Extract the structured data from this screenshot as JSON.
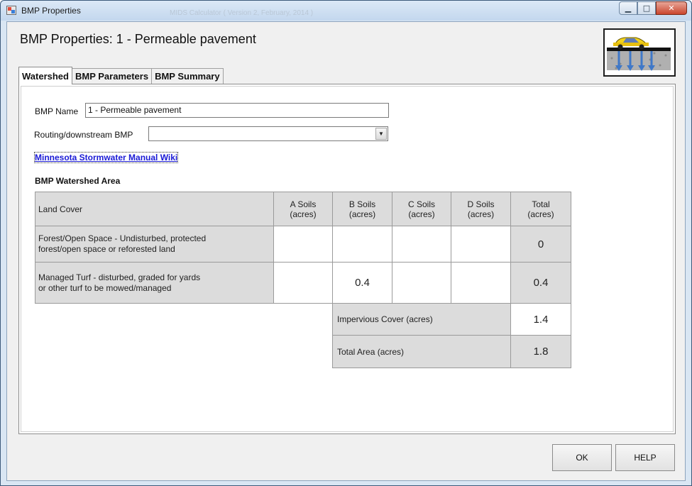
{
  "window": {
    "title": "BMP Properties",
    "background_title": "MIDS Calculator ( Version 2, February, 2014 )",
    "controls": {
      "minimize": "▁",
      "maximize": "□",
      "close": "✕"
    }
  },
  "header": {
    "title": "BMP Properties: 1 - Permeable pavement"
  },
  "tabs": [
    {
      "label": "Watershed",
      "active": true
    },
    {
      "label": "BMP Parameters",
      "active": false
    },
    {
      "label": "BMP Summary",
      "active": false
    }
  ],
  "form": {
    "bmp_name_label": "BMP Name",
    "bmp_name_value": "1 - Permeable pavement",
    "routing_label": "Routing/downstream BMP",
    "routing_value": "",
    "routing_arrow": "▼",
    "wiki_link": "Minnesota Stormwater Manual Wiki"
  },
  "watershed": {
    "section_title": "BMP Watershed Area",
    "headers": {
      "land_cover": "Land Cover",
      "a_soils": [
        "A Soils",
        "(acres)"
      ],
      "b_soils": [
        "B Soils",
        "(acres)"
      ],
      "c_soils": [
        "C Soils",
        "(acres)"
      ],
      "d_soils": [
        "D Soils",
        "(acres)"
      ],
      "total": [
        "Total",
        "(acres)"
      ]
    },
    "rows": [
      {
        "land_cover": [
          "Forest/Open Space - Undisturbed, protected",
          "forest/open space or reforested land"
        ],
        "a": "",
        "b": "",
        "c": "",
        "d": "",
        "total": "0"
      },
      {
        "land_cover": [
          "Managed Turf - disturbed, graded for yards",
          "or other turf to be mowed/managed"
        ],
        "a": "",
        "b": "0.4",
        "c": "",
        "d": "",
        "total": "0.4"
      }
    ],
    "impervious_label": "Impervious Cover (acres)",
    "impervious_value": "1.4",
    "total_area_label": "Total Area (acres)",
    "total_area_value": "1.8"
  },
  "buttons": {
    "ok": "OK",
    "help": "HELP"
  },
  "colors": {
    "accent_link": "#1a1ad6",
    "cell_gray": "#dcdcdc"
  }
}
